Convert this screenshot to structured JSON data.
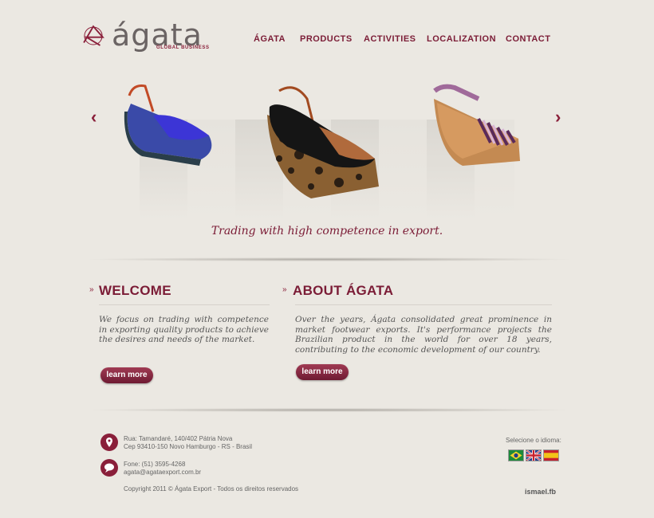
{
  "logo": {
    "name": "ágata",
    "tagline": "GLOBAL BUSINESS"
  },
  "nav": [
    "ÁGATA",
    "PRODUCTS",
    "ACTIVITIES",
    "LOCALIZATION",
    "CONTACT"
  ],
  "slider": {
    "tagline": "Trading with high competence in export."
  },
  "welcome": {
    "title": "WELCOME",
    "text": "We focus on trading with competence in exporting quality products to achieve the desires and needs of the market.",
    "button": "learn more"
  },
  "about": {
    "title": "ABOUT ÁGATA",
    "text": "Over the years, Ágata consolidated great prominence in market footwear exports. It's performance projects the Brazilian product in the world for over 18 years, contributing to the economic development of our country.",
    "button": "learn more"
  },
  "footer": {
    "address_line1": "Rua: Tamandaré, 140/402 Pátria Nova",
    "address_line2": "Cep 93410-150 Novo Hamburgo - RS - Brasil",
    "phone": "Fone: (51) 3595-4268",
    "email": "agata@agataexport.com.br",
    "copyright": "Copyright 2011 © Ágata Export - Todos os direitos reservados",
    "language_label": "Selecione o idioma:",
    "credit": "ismael.fb"
  },
  "colors": {
    "brand": "#7b1c36",
    "background": "#ebe8e2"
  }
}
